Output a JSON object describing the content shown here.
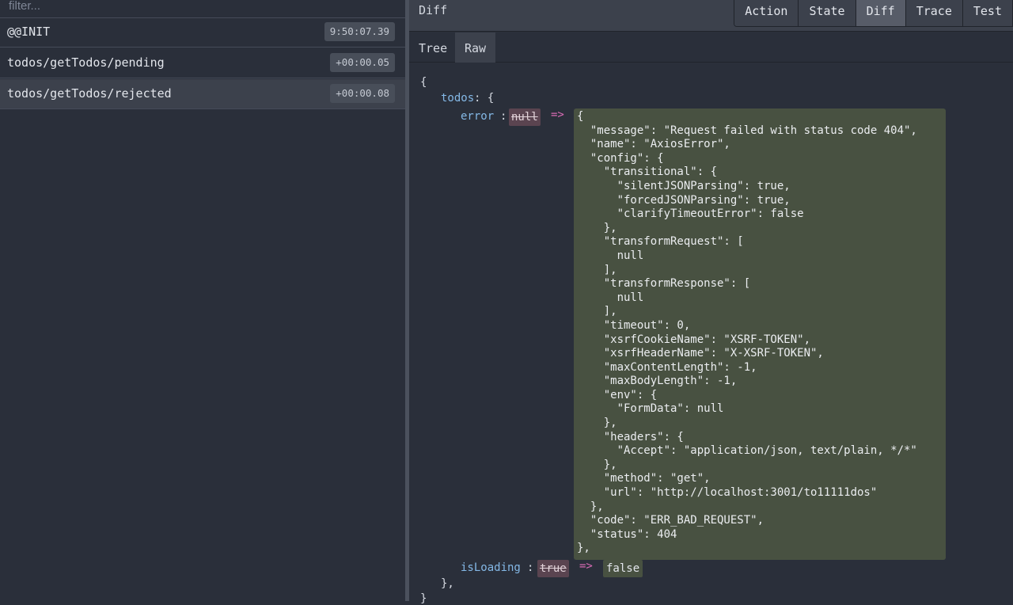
{
  "filter": {
    "placeholder": "filter..."
  },
  "actions": [
    {
      "name": "@@INIT",
      "time": "9:50:07.39"
    },
    {
      "name": "todos/getTodos/pending",
      "time": "+00:00.05"
    },
    {
      "name": "todos/getTodos/rejected",
      "time": "+00:00.08"
    }
  ],
  "monitor": {
    "title": "Diff",
    "tabs": [
      "Action",
      "State",
      "Diff",
      "Trace",
      "Test"
    ],
    "active_tab": "Diff",
    "view_tabs": [
      "Tree",
      "Raw"
    ],
    "active_view": "Raw"
  },
  "diff": {
    "open_brace": "{",
    "todos_key": "todos",
    "todos_open": ": {",
    "error_key": "error",
    "colon": ":",
    "error_old": "null",
    "arrow": "=>",
    "error_new_json": "{\n  \"message\": \"Request failed with status code 404\",\n  \"name\": \"AxiosError\",\n  \"config\": {\n    \"transitional\": {\n      \"silentJSONParsing\": true,\n      \"forcedJSONParsing\": true,\n      \"clarifyTimeoutError\": false\n    },\n    \"transformRequest\": [\n      null\n    ],\n    \"transformResponse\": [\n      null\n    ],\n    \"timeout\": 0,\n    \"xsrfCookieName\": \"XSRF-TOKEN\",\n    \"xsrfHeaderName\": \"X-XSRF-TOKEN\",\n    \"maxContentLength\": -1,\n    \"maxBodyLength\": -1,\n    \"env\": {\n      \"FormData\": null\n    },\n    \"headers\": {\n      \"Accept\": \"application/json, text/plain, */*\"\n    },\n    \"method\": \"get\",\n    \"url\": \"http://localhost:3001/to11111dos\"\n  },\n  \"code\": \"ERR_BAD_REQUEST\",\n  \"status\": 404\n},",
    "isloading_key": "isLoading",
    "isloading_old": "true",
    "isloading_new": "false",
    "todos_close": "},",
    "close_brace": "}"
  },
  "colors": {
    "background": "#2a2f3a",
    "removed_bg": "#5a4450",
    "added_bg": "#485141",
    "key": "#84b8e6",
    "arrow": "#d86bb4"
  }
}
